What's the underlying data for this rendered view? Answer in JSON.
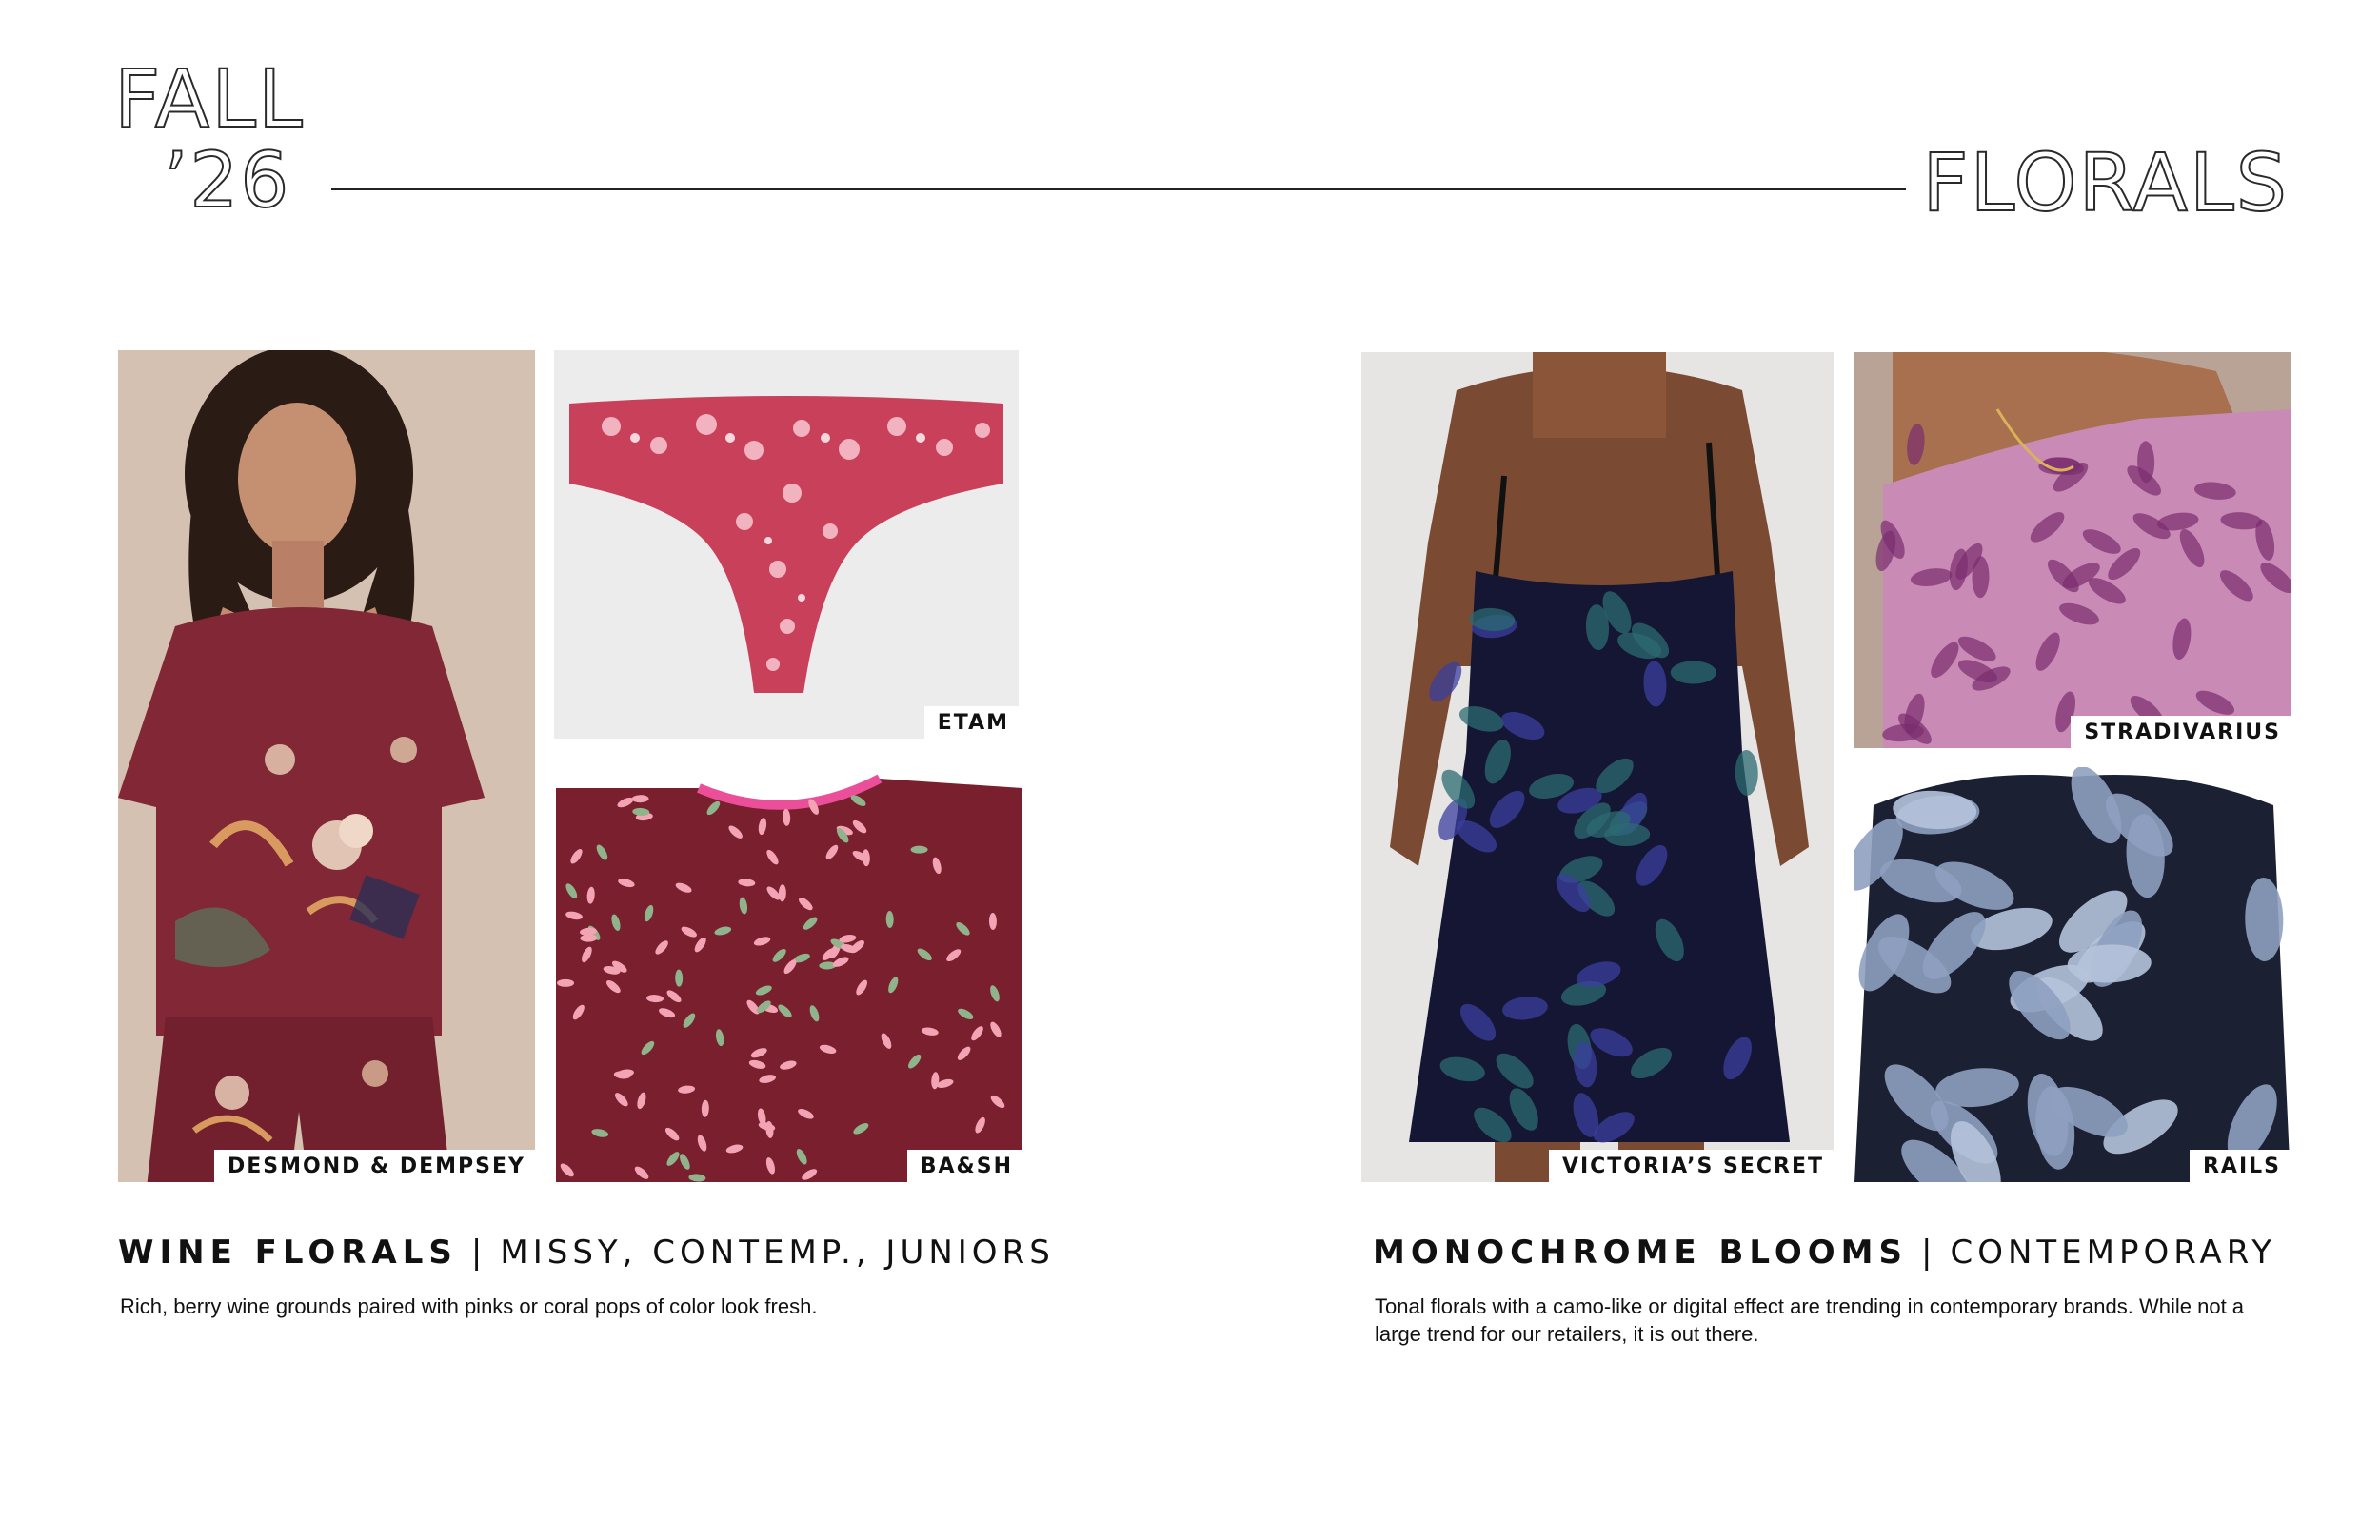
{
  "header": {
    "season_line1": "FALL",
    "season_line2": "’26",
    "topic": "FLORALS"
  },
  "left_section": {
    "title_strong": "WINE FLORALS",
    "separator": "|",
    "title_markets": "MISSY, CONTEMP., JUNIORS",
    "description": "Rich, berry wine grounds paired with pinks or coral pops of color look fresh.",
    "images": [
      {
        "brand": "DESMOND & DEMPSEY",
        "subject": "model in wine floral pajama set"
      },
      {
        "brand": "ETAM",
        "subject": "pink floral lace thong"
      },
      {
        "brand": "BA&SH",
        "subject": "wine ditsy floral print top detail"
      }
    ]
  },
  "right_section": {
    "title_strong": "MONOCHROME BLOOMS",
    "separator": "|",
    "title_markets": "CONTEMPORARY",
    "description": "Tonal florals with a camo-like or digital effect are trending in contemporary brands. While not a large trend for our retailers, it is out there.",
    "images": [
      {
        "brand": "VICTORIA’S SECRET",
        "subject": "navy burnout velvet floral slip dress"
      },
      {
        "brand": "STRADIVARIUS",
        "subject": "purple tie-dye floral one-shoulder top"
      },
      {
        "brand": "RAILS",
        "subject": "blue-grey tonal floral long sleeve top"
      }
    ]
  },
  "colors": {
    "wine": "#7a2230",
    "berry_pink": "#d9566f",
    "navy_velvet": "#141634",
    "violet": "#a8578c",
    "slate_blue": "#8ea0c0"
  }
}
